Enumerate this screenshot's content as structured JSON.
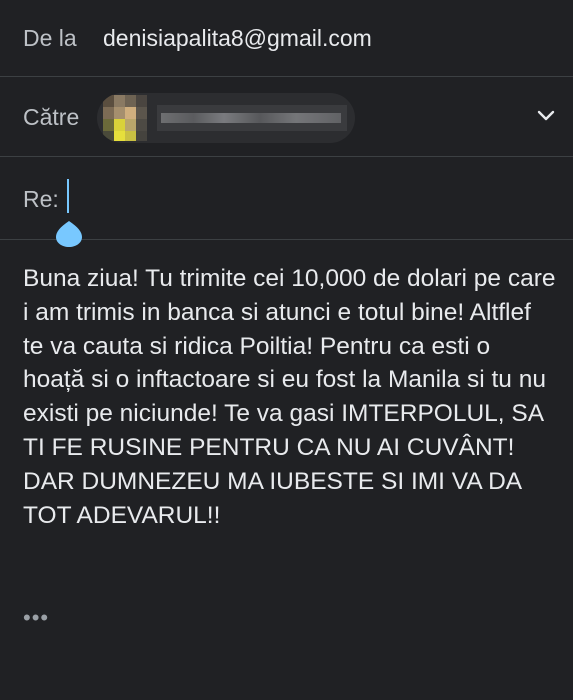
{
  "header": {
    "from_label": "De la",
    "from_email": "denisiapalita8@gmail.com",
    "to_label": "Către",
    "to_icon": "chevron-down-icon",
    "subject_label": "Re:",
    "subject_value": ""
  },
  "body": {
    "text": " Buna ziua! Tu trimite cei 10,000 de dolari pe care i am trimis in banca si atunci e totul bine! Altflef te va cauta si ridica Poiltia! Pentru ca esti o hoață si o inftactoare si eu  fost la Manila si tu nu existi pe niciunde! Te va gasi IMTERPOLUL,  SA TI FE RUSINE PENTRU CA  NU AI CUVÂNT! DAR DUMNEZEU MA IUBESTE SI IMI VA DA TOT ADEVARUL!!",
    "quoted_text_toggle": "•••"
  },
  "colors": {
    "background": "#202124",
    "divider": "#3c4043",
    "text": "#e8eaed",
    "label": "#bdc1c6",
    "cursor": "#78c8ff"
  }
}
